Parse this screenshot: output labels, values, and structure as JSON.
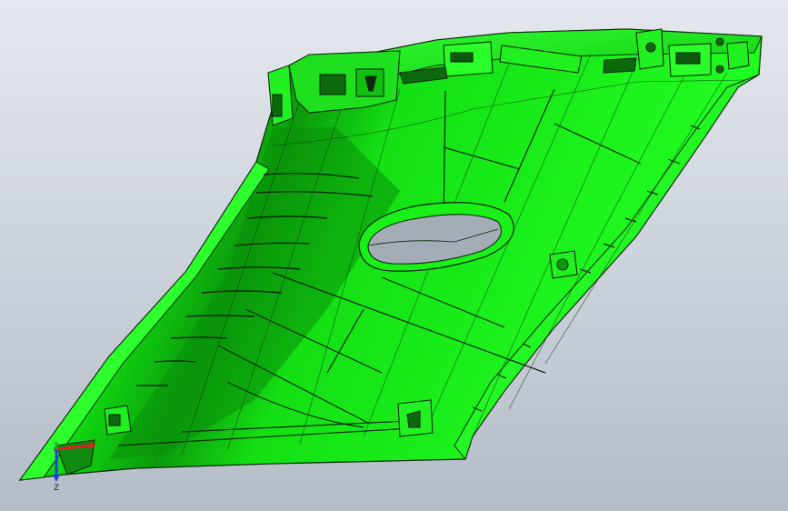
{
  "window": {
    "title": ""
  },
  "viewport": {
    "background_top": "#e4e8ee",
    "background_bottom": "#b4bcc7"
  },
  "part": {
    "color": "#11f011",
    "edge_color": "#0d2a0d",
    "shade_color": "#0c9a0c",
    "highlight_color": "#8bff8b"
  },
  "triad": {
    "x_color": "#e02020",
    "y_color": "#20b020",
    "z_color": "#2040e0",
    "z_label": "Z"
  }
}
